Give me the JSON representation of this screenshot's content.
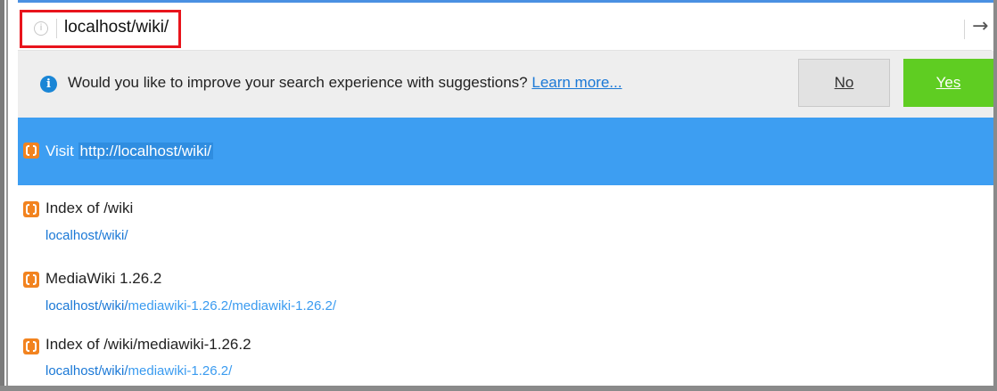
{
  "urlbar": {
    "url": "localhost/wiki/",
    "info_icon": "info-circle-icon",
    "go_icon": "arrow-right-icon",
    "go_glyph": "→"
  },
  "notice": {
    "icon": "info-icon",
    "icon_glyph": "i",
    "message": "Would you like to improve your search experience with suggestions?",
    "link_label": "Learn more...",
    "no_label": "No",
    "yes_label": "Yes"
  },
  "visit": {
    "prefix": "Visit",
    "url": "http://localhost/wiki/",
    "icon": "xampp-favicon-icon"
  },
  "results": [
    {
      "title": "Index of /wiki",
      "host": "localhost/wiki/",
      "path": ""
    },
    {
      "title": "MediaWiki 1.26.2",
      "host": "localhost/wiki/",
      "path": "mediawiki-1.26.2/mediawiki-1.26.2/"
    },
    {
      "title": "Index of /wiki/mediawiki-1.26.2",
      "host": "localhost/wiki/",
      "path": "mediawiki-1.26.2/"
    }
  ],
  "colors": {
    "selected_row": "#3d9ef2",
    "yes_button": "#5fcd22",
    "highlight_box": "#e8141c",
    "link": "#1a78d6"
  }
}
